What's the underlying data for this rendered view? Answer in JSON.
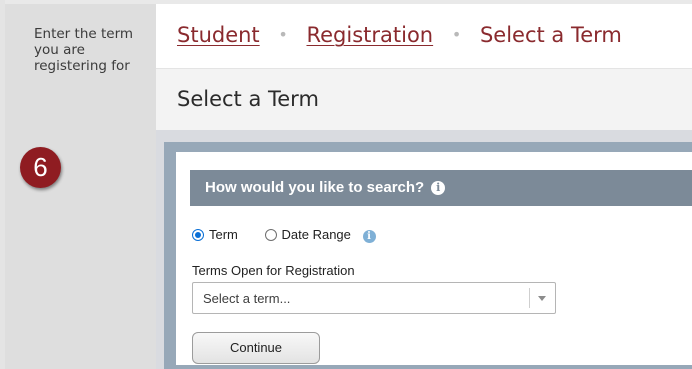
{
  "instruction": {
    "text": "Enter the term you are registering for",
    "step_number": "6",
    "badge_color": "#8f1c21"
  },
  "breadcrumb": {
    "items": [
      "Student",
      "Registration"
    ],
    "separator": "•",
    "current": "Select a Term"
  },
  "page": {
    "title": "Select a Term"
  },
  "search_panel": {
    "header": "How would you like to search?",
    "header_icon": "info-icon",
    "options": [
      {
        "label": "Term",
        "checked": true
      },
      {
        "label": "Date Range",
        "checked": false
      }
    ],
    "date_range_icon": "info-icon",
    "terms_label": "Terms Open for Registration",
    "term_select_placeholder": "Select a term...",
    "continue_label": "Continue"
  },
  "colors": {
    "accent": "#8a2a2e",
    "header_bg": "#7c8a98",
    "radio_selected": "#0a6fd6"
  }
}
